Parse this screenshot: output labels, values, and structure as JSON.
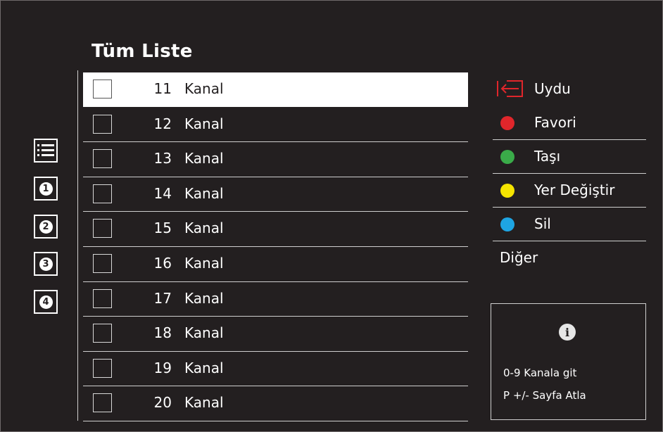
{
  "title": "Tüm Liste",
  "side_icons": [
    {
      "name": "list-icon",
      "glyph": ""
    },
    {
      "name": "list-1-icon",
      "glyph": "1"
    },
    {
      "name": "list-2-icon",
      "glyph": "2"
    },
    {
      "name": "list-3-icon",
      "glyph": "3"
    },
    {
      "name": "list-4-icon",
      "glyph": "4"
    }
  ],
  "channels": [
    {
      "num": "11",
      "name": "Kanal",
      "selected": true
    },
    {
      "num": "12",
      "name": "Kanal",
      "selected": false
    },
    {
      "num": "13",
      "name": "Kanal",
      "selected": false
    },
    {
      "num": "14",
      "name": "Kanal",
      "selected": false
    },
    {
      "num": "15",
      "name": "Kanal",
      "selected": false
    },
    {
      "num": "16",
      "name": "Kanal",
      "selected": false
    },
    {
      "num": "17",
      "name": "Kanal",
      "selected": false
    },
    {
      "num": "18",
      "name": "Kanal",
      "selected": false
    },
    {
      "num": "19",
      "name": "Kanal",
      "selected": false
    },
    {
      "num": "20",
      "name": "Kanal",
      "selected": false
    }
  ],
  "options": [
    {
      "label": "Uydu",
      "icon": "source-input-icon",
      "color": "#e0262b"
    },
    {
      "label": "Favori",
      "icon": "red-dot-icon",
      "color": "#e0262b"
    },
    {
      "label": "Taşı",
      "icon": "green-dot-icon",
      "color": "#3aab49"
    },
    {
      "label": "Yer Değiştir",
      "icon": "yellow-dot-icon",
      "color": "#f5e400"
    },
    {
      "label": "Sil",
      "icon": "blue-dot-icon",
      "color": "#1ea5e3"
    },
    {
      "label": "Diğer",
      "icon": "",
      "color": ""
    }
  ],
  "info": {
    "icon": "info-icon",
    "line1": "0-9 Kanala git",
    "line2": "P +/- Sayfa Atla"
  }
}
